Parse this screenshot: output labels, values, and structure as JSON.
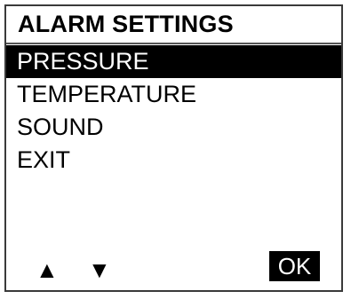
{
  "header": {
    "title": "ALARM SETTINGS"
  },
  "menu": {
    "items": [
      {
        "label": "PRESSURE",
        "selected": true
      },
      {
        "label": "TEMPERATURE",
        "selected": false
      },
      {
        "label": "SOUND",
        "selected": false
      },
      {
        "label": "EXIT",
        "selected": false
      }
    ]
  },
  "softkeys": {
    "up_icon": "▲",
    "down_icon": "▼",
    "ok_label": "OK"
  },
  "colors": {
    "highlight_background": "#000000",
    "highlight_text": "#ffffff",
    "background": "#ffffff",
    "border": "#3a3a3a"
  }
}
